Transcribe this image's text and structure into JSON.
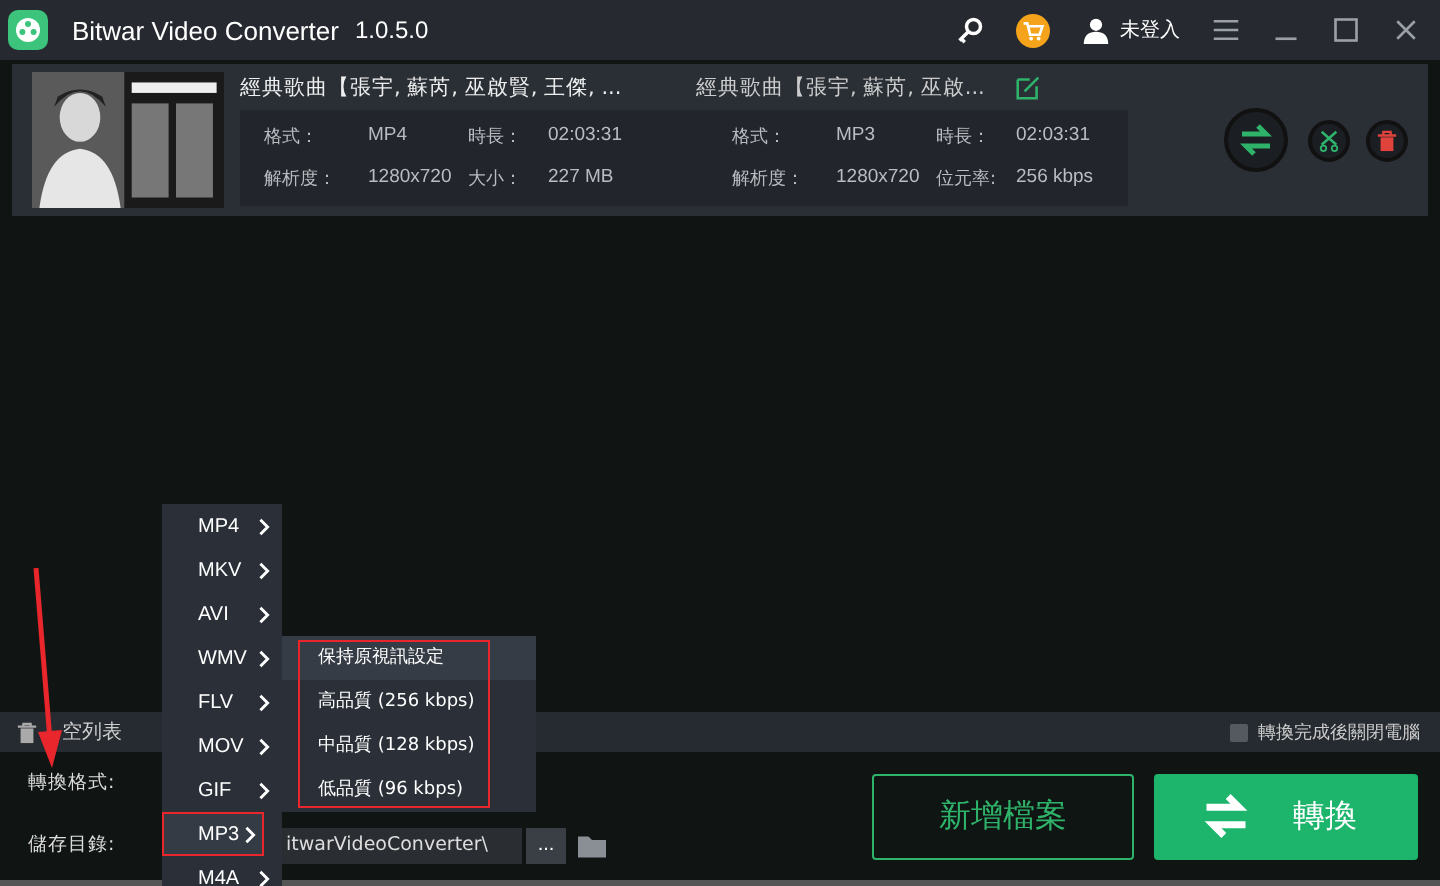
{
  "title_bar": {
    "app_name": "Bitwar Video Converter",
    "version": "1.0.5.0",
    "user": "未登入"
  },
  "files": [
    {
      "source_title": "經典歌曲【張宇, 蘇芮, 巫啟賢, 王傑, ...",
      "target_title": "經典歌曲【張宇, 蘇芮, 巫啟...",
      "source_props": [
        {
          "label": "格式：",
          "value": "MP4"
        },
        {
          "label": "時長：",
          "value": "02:03:31"
        },
        {
          "label": "解析度：",
          "value": "1280x720"
        },
        {
          "label": "大小：",
          "value": "227 MB"
        }
      ],
      "target_props": [
        {
          "label": "格式：",
          "value": "MP3"
        },
        {
          "label": "時長：",
          "value": "02:03:31"
        },
        {
          "label": "解析度：",
          "value": "1280x720"
        },
        {
          "label": "位元率:",
          "value": "256 kbps"
        }
      ]
    }
  ],
  "toolbar": {
    "clear_label": "空列表",
    "shutdown_option": {
      "label": "轉換完成後關閉電腦",
      "checked": false
    }
  },
  "output": {
    "format_label": "轉換格式:",
    "save_label": "儲存目錄:",
    "save_path": "itwarVideoConverter\\",
    "browse": "..."
  },
  "buttons": {
    "add": "新增檔案",
    "convert": "轉換"
  },
  "format_menu": [
    {
      "label": "MP4",
      "selected": false
    },
    {
      "label": "MKV",
      "selected": false
    },
    {
      "label": "AVI",
      "selected": false
    },
    {
      "label": "WMV",
      "selected": false
    },
    {
      "label": "FLV",
      "selected": false
    },
    {
      "label": "MOV",
      "selected": false
    },
    {
      "label": "GIF",
      "selected": false
    },
    {
      "label": "MP3",
      "selected": true
    },
    {
      "label": "M4A",
      "selected": false
    }
  ],
  "quality_menu": [
    {
      "label": "保持原視訊設定",
      "selected": true
    },
    {
      "label": "高品質 (256 kbps)",
      "selected": false
    },
    {
      "label": "中品質 (128 kbps)",
      "selected": false
    },
    {
      "label": "低品質 (96 kbps)",
      "selected": false
    }
  ]
}
